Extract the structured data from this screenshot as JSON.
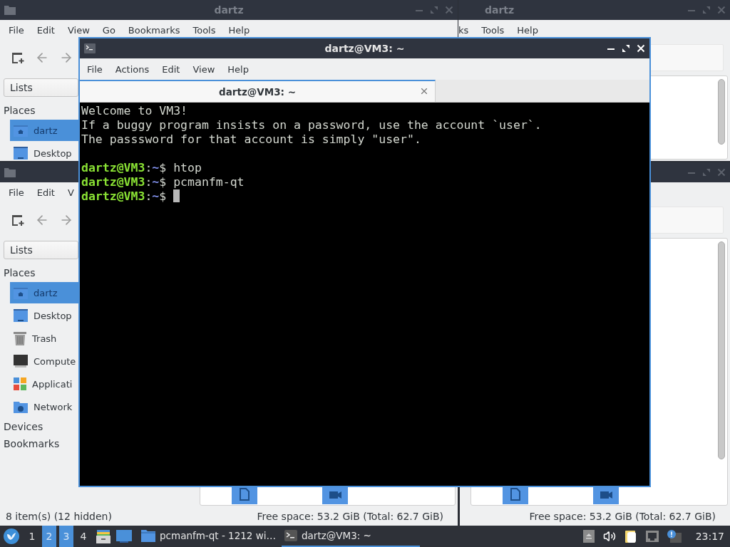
{
  "file_windows": [
    {
      "kind": "sidebar",
      "title": "dartz",
      "controls": true,
      "menu": [
        "File",
        "Edit",
        "View",
        "Go",
        "Bookmarks",
        "Tools",
        "Help"
      ],
      "side_tab": "Lists",
      "places_heading": "Places",
      "places": [
        {
          "label": "dartz",
          "kind": "home",
          "selected": true
        },
        {
          "label": "Desktop",
          "kind": "desktop",
          "selected": false
        }
      ]
    },
    {
      "kind": "view",
      "title": "dartz",
      "controls": true,
      "menu": [
        "ks",
        "Tools",
        "Help"
      ]
    },
    {
      "kind": "sidebar",
      "controls": false,
      "menu": [
        "File",
        "Edit",
        "V"
      ],
      "side_tab": "Lists",
      "places_heading": "Places",
      "places": [
        {
          "label": "dartz",
          "kind": "home",
          "selected": true
        },
        {
          "label": "Desktop",
          "kind": "desktop",
          "selected": false
        },
        {
          "label": "Trash",
          "kind": "trash",
          "selected": false
        },
        {
          "label": "Compute",
          "kind": "computer",
          "selected": false
        },
        {
          "label": "Applicati",
          "kind": "applications",
          "selected": false
        },
        {
          "label": "Network",
          "kind": "network",
          "selected": false
        }
      ],
      "sections": [
        "Devices",
        "Bookmarks"
      ],
      "folders": [
        {
          "kind": "documents"
        },
        {
          "kind": "videos"
        }
      ],
      "status": {
        "items": "8 item(s) (12 hidden)",
        "space": "Free space: 53.2 GiB (Total: 62.7 GiB)"
      }
    },
    {
      "kind": "view",
      "controls": true,
      "folders": [
        {
          "kind": "documents"
        },
        {
          "kind": "videos"
        }
      ],
      "status": {
        "space": "Free space: 53.2 GiB (Total: 62.7 GiB)"
      }
    }
  ],
  "terminal": {
    "title": "dartz@VM3: ~",
    "menu": [
      "File",
      "Actions",
      "Edit",
      "View",
      "Help"
    ],
    "tabs": [
      {
        "label": "dartz@VM3: ~",
        "selected": true
      }
    ],
    "lines": [
      {
        "kind": "text",
        "text": "Welcome to VM3!"
      },
      {
        "kind": "text",
        "text": "If a buggy program insists on a password, use the account `user`."
      },
      {
        "kind": "text",
        "text": "The passsword for that account is simply \"user\"."
      },
      {
        "kind": "blank"
      },
      {
        "kind": "prompt",
        "user": "dartz@VM3",
        "sep": ":",
        "path": "~",
        "symbol": "$ ",
        "command": "htop",
        "cursor": false
      },
      {
        "kind": "prompt",
        "user": "dartz@VM3",
        "sep": ":",
        "path": "~",
        "symbol": "$ ",
        "command": "pcmanfm-qt",
        "cursor": false
      },
      {
        "kind": "prompt",
        "user": "dartz@VM3",
        "sep": ":",
        "path": "~",
        "symbol": "$ ",
        "cursor": true
      }
    ]
  },
  "taskbar": {
    "desktops": [
      {
        "label": "1",
        "selected": false
      },
      {
        "label": "2",
        "selected": true
      },
      {
        "label": "3",
        "selected": true
      },
      {
        "label": "4",
        "selected": false
      }
    ],
    "tasks": [
      {
        "label": "pcmanfm-qt - 1212 wi…",
        "kind": "folder",
        "selected": false
      },
      {
        "label": "dartz@VM3: ~",
        "kind": "terminal",
        "selected": true
      }
    ],
    "clock": "23:17"
  }
}
